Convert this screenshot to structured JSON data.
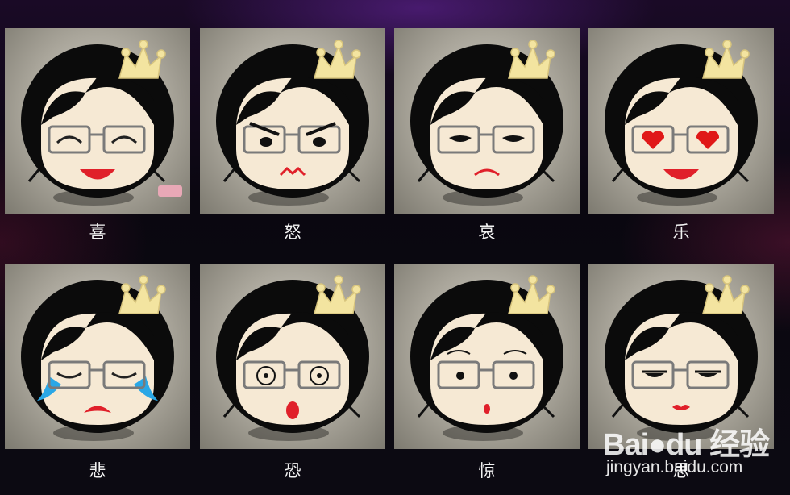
{
  "emotions": [
    {
      "label": "喜"
    },
    {
      "label": "怒"
    },
    {
      "label": "哀"
    },
    {
      "label": "乐"
    },
    {
      "label": "悲"
    },
    {
      "label": "恐"
    },
    {
      "label": "惊"
    },
    {
      "label": "思"
    }
  ],
  "watermark": {
    "logo_left": "Bai",
    "logo_right": "du",
    "logo_suffix": "经验",
    "url": "jingyan.baidu.com"
  },
  "colors": {
    "hair": "#0b0b0b",
    "skin": "#f6e9d4",
    "crown": "#f3e4a0",
    "mouth_red": "#e0202a",
    "tears": "#2aa7e6",
    "heart": "#e01818"
  }
}
